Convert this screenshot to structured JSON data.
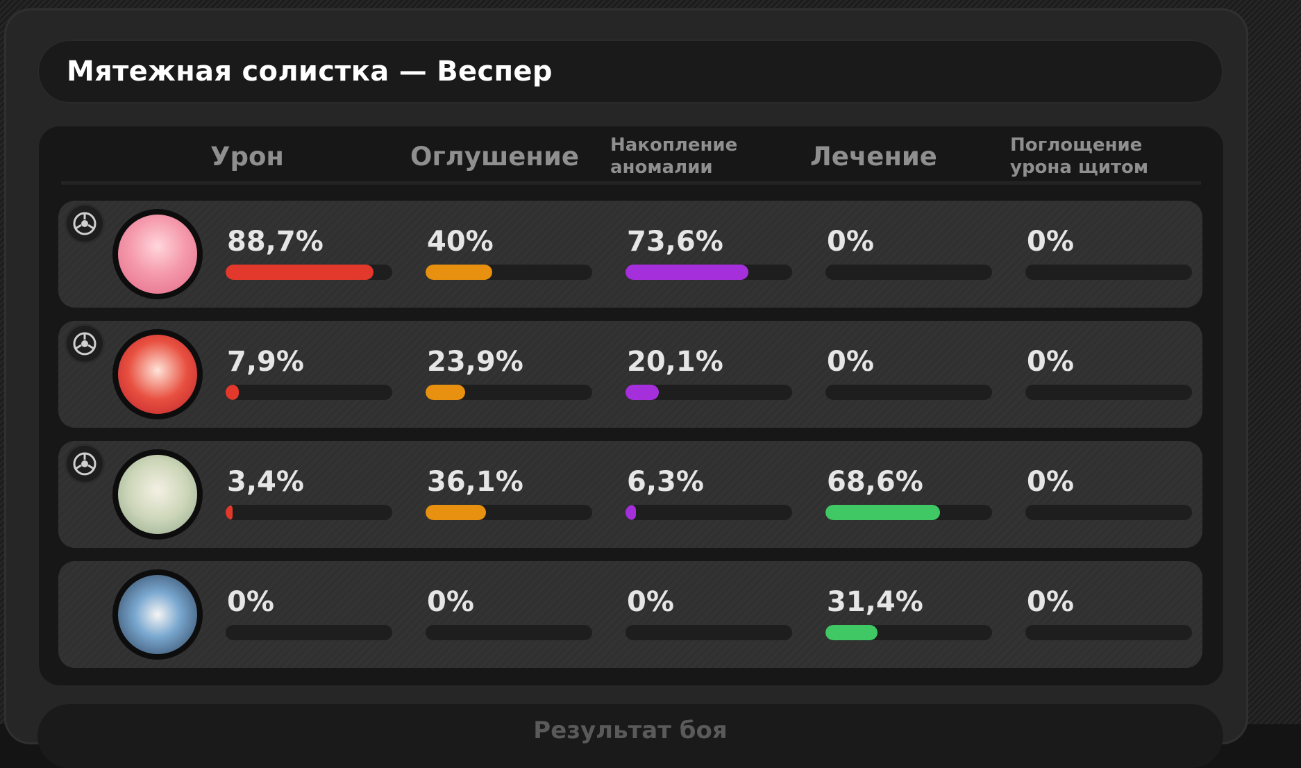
{
  "title": "Мятежная солистка — Веспер",
  "columns": {
    "damage": "Урон",
    "stun": "Оглушение",
    "anomaly_line1": "Накопление",
    "anomaly_line2": "аномалии",
    "healing": "Лечение",
    "shield_line1": "Поглощение",
    "shield_line2": "урона щитом"
  },
  "colors": {
    "damage": "#e2392c",
    "stun": "#e8900f",
    "anomaly": "#a62fdc",
    "healing": "#3fc864",
    "shield": "#3f7fe0"
  },
  "rows": [
    {
      "avatar_icon": "pink-hair-agent-portrait",
      "badge_icon": "attack-role-icon",
      "has_badge": true,
      "damage": {
        "label": "88,7%",
        "value": 0.887
      },
      "stun": {
        "label": "40%",
        "value": 0.4
      },
      "anomaly": {
        "label": "73,6%",
        "value": 0.736
      },
      "healing": {
        "label": "0%",
        "value": 0
      },
      "shield": {
        "label": "0%",
        "value": 0
      }
    },
    {
      "avatar_icon": "red-hair-agent-portrait",
      "badge_icon": "support-role-icon",
      "has_badge": true,
      "damage": {
        "label": "7,9%",
        "value": 0.079
      },
      "stun": {
        "label": "23,9%",
        "value": 0.239
      },
      "anomaly": {
        "label": "20,1%",
        "value": 0.201
      },
      "healing": {
        "label": "0%",
        "value": 0
      },
      "shield": {
        "label": "0%",
        "value": 0
      }
    },
    {
      "avatar_icon": "green-hair-agent-portrait",
      "badge_icon": "support-role-icon",
      "has_badge": true,
      "damage": {
        "label": "3,4%",
        "value": 0.034
      },
      "stun": {
        "label": "36,1%",
        "value": 0.361
      },
      "anomaly": {
        "label": "6,3%",
        "value": 0.063
      },
      "healing": {
        "label": "68,6%",
        "value": 0.686
      },
      "shield": {
        "label": "0%",
        "value": 0
      }
    },
    {
      "avatar_icon": "bangboo-portrait",
      "badge_icon": "",
      "has_badge": false,
      "damage": {
        "label": "0%",
        "value": 0
      },
      "stun": {
        "label": "0%",
        "value": 0
      },
      "anomaly": {
        "label": "0%",
        "value": 0
      },
      "healing": {
        "label": "31,4%",
        "value": 0.314
      },
      "shield": {
        "label": "0%",
        "value": 0
      }
    }
  ],
  "footer": "Результат боя"
}
